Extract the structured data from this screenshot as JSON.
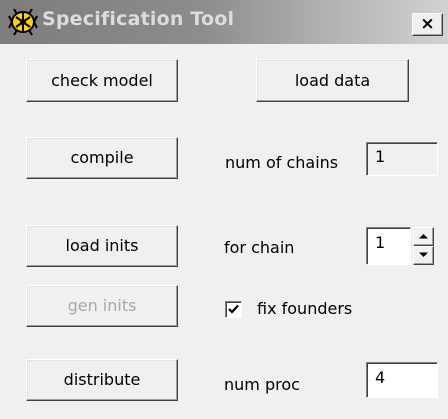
{
  "window": {
    "title": "Specification Tool",
    "close_label": "×",
    "icon": "winbugs-bug-icon"
  },
  "buttons": {
    "check_model": "check model",
    "load_data": "load data",
    "compile": "compile",
    "load_inits": "load inits",
    "gen_inits": "gen inits",
    "distribute": "distribute"
  },
  "labels": {
    "num_of_chains": "num of chains",
    "for_chain": "for chain",
    "fix_founders": "fix founders",
    "num_proc": "num proc"
  },
  "fields": {
    "num_of_chains_value": "1",
    "for_chain_value": "1",
    "num_proc_value": "4"
  },
  "state": {
    "fix_founders_checked": true,
    "gen_inits_enabled": false
  },
  "colors": {
    "face": "#f0f0f0",
    "title_text": "#dcdcdc",
    "disabled_text": "#a8a8a8",
    "icon_yellow": "#ffd400"
  }
}
